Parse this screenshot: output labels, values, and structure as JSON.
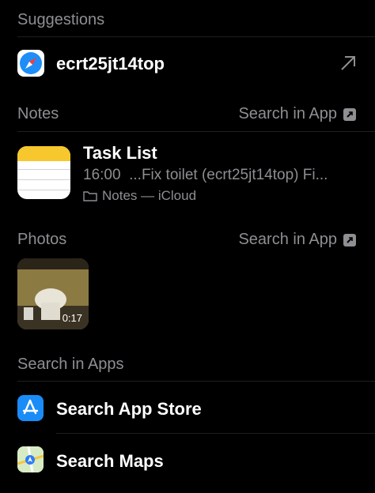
{
  "suggestions": {
    "title": "Suggestions",
    "item": {
      "label": "ecrt25jt14top",
      "icon": "safari-icon"
    }
  },
  "notes": {
    "title": "Notes",
    "search_in_app": "Search in App",
    "result": {
      "title": "Task List",
      "time": "16:00",
      "snippet": "...Fix toilet (ecrt25jt14top) Fi...",
      "location": "Notes — iCloud"
    }
  },
  "photos": {
    "title": "Photos",
    "search_in_app": "Search in App",
    "thumbnail": {
      "duration": "0:17"
    }
  },
  "search_in_apps": {
    "title": "Search in Apps",
    "items": [
      {
        "label": "Search App Store",
        "icon": "app-store-icon"
      },
      {
        "label": "Search Maps",
        "icon": "maps-icon"
      }
    ]
  },
  "colors": {
    "background": "#000000",
    "secondary_text": "#8e8e93",
    "divider": "#1f1f1f"
  }
}
